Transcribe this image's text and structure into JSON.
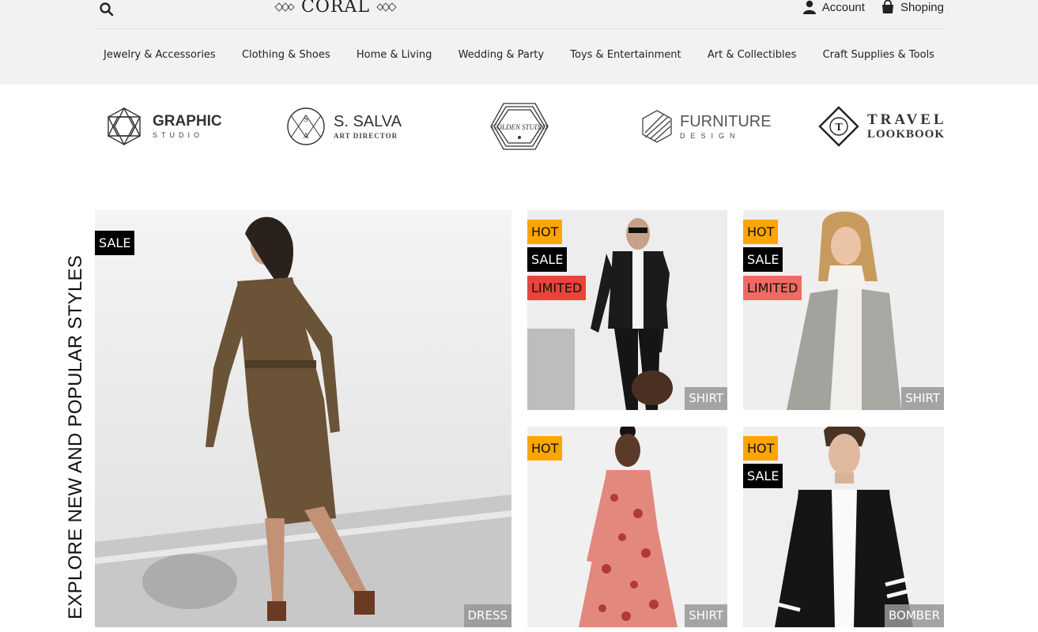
{
  "header": {
    "logo_text": "CORAL",
    "account_label": "Account",
    "shopping_label": "Shoping"
  },
  "nav": {
    "items": [
      "Jewelry & Accessories",
      "Clothing & Shoes",
      "Home & Living",
      "Wedding & Party",
      "Toys & Entertainment",
      "Art & Collectibles",
      "Craft Supplies & Tools"
    ]
  },
  "brands": {
    "graphic": {
      "main": "GRAPHIC",
      "sub": "STUDIO"
    },
    "salva": {
      "main": "S. SALVA",
      "sub": "ART DIRECTOR",
      "mark_top": "S",
      "mark_bottom": "A"
    },
    "golden": {
      "text": "GOLDEN STUDIO"
    },
    "furniture": {
      "main": "FURNITURE",
      "sub": "DESIGN"
    },
    "travel": {
      "main": "TRAVEL",
      "sub": "LOOKBOOK",
      "mark": "T"
    }
  },
  "section": {
    "title": "EXPLORE NEW AND POPULAR STYLES"
  },
  "products": [
    {
      "badges": [
        "SALE"
      ],
      "category": "DRESS"
    },
    {
      "badges": [
        "HOT",
        "SALE",
        "LIMITED"
      ],
      "category": "SHIRT"
    },
    {
      "badges": [
        "HOT",
        "SALE",
        "LIMITED"
      ],
      "category": "SHIRT"
    },
    {
      "badges": [
        "HOT"
      ],
      "category": "SHIRT"
    },
    {
      "badges": [
        "HOT",
        "SALE"
      ],
      "category": "BOMBER"
    }
  ],
  "colors": {
    "hot": "#ffa500",
    "sale": "#000000",
    "limited": "#e8443a",
    "header_bg": "#f2f2f2"
  },
  "icons": {
    "search": "search-icon",
    "account": "user-icon",
    "shopping": "shopping-bag-icon"
  }
}
